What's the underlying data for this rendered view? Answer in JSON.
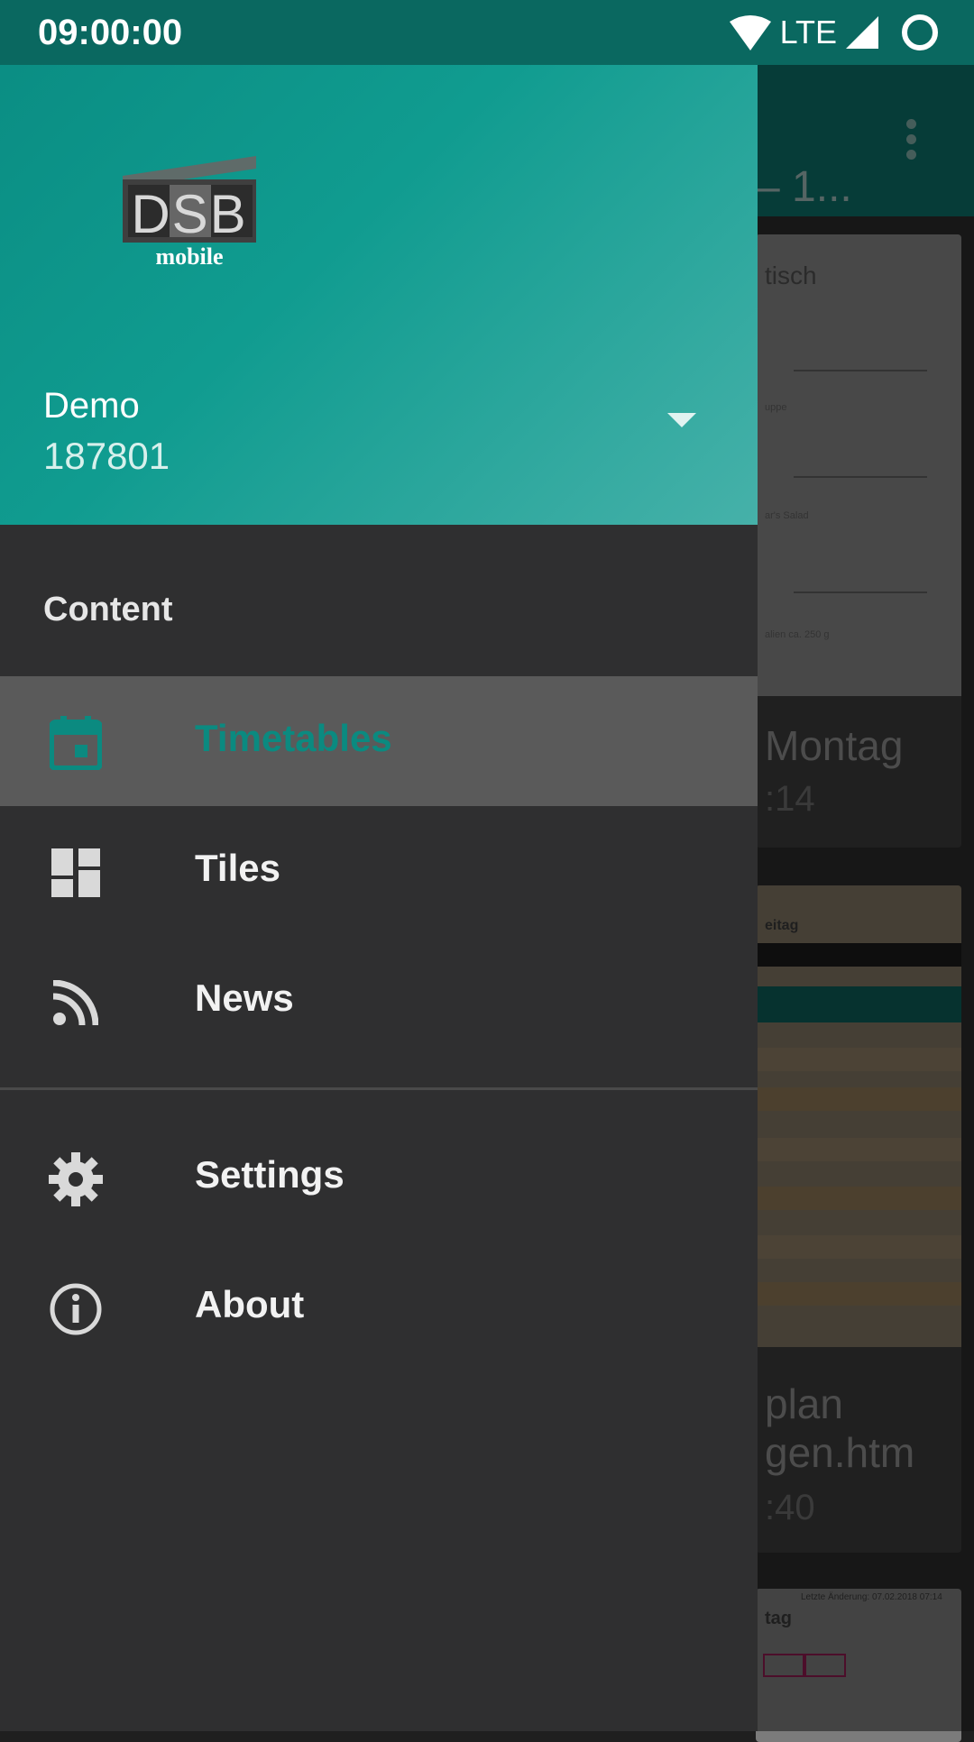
{
  "status_bar": {
    "time": "09:00:00",
    "network": "LTE"
  },
  "background": {
    "toolbar_title_fragment": "– 1...",
    "cards": [
      {
        "title_fragment": "Montag",
        "subtitle_fragment": ":14",
        "preview_heading": "tisch",
        "preview_item": "uppe",
        "preview_item2": "ar's Salad",
        "preview_item3": "alien ca. 250 g"
      },
      {
        "title_fragment": "plan",
        "title_fragment2": "gen.htm",
        "subtitle_fragment": ":40",
        "preview_heading": "eitag"
      },
      {
        "preview_heading": "tag",
        "preview_note": "Letzte Änderung: 07.02.2018 07:14"
      }
    ]
  },
  "drawer": {
    "header": {
      "logo_text": "DSB",
      "logo_subtext": "mobile",
      "account_name": "Demo",
      "account_id": "187801"
    },
    "section_title": "Content",
    "items": [
      {
        "label": "Timetables",
        "icon": "calendar-icon",
        "active": true
      },
      {
        "label": "Tiles",
        "icon": "dashboard-icon",
        "active": false
      },
      {
        "label": "News",
        "icon": "rss-icon",
        "active": false
      },
      {
        "label": "Settings",
        "icon": "gear-icon",
        "active": false
      },
      {
        "label": "About",
        "icon": "info-icon",
        "active": false
      }
    ]
  },
  "colors": {
    "primary": "#0b8a80",
    "status_bar": "#0a6860",
    "drawer_bg": "#2f2f30",
    "active_item_bg": "#5a5a5a"
  }
}
